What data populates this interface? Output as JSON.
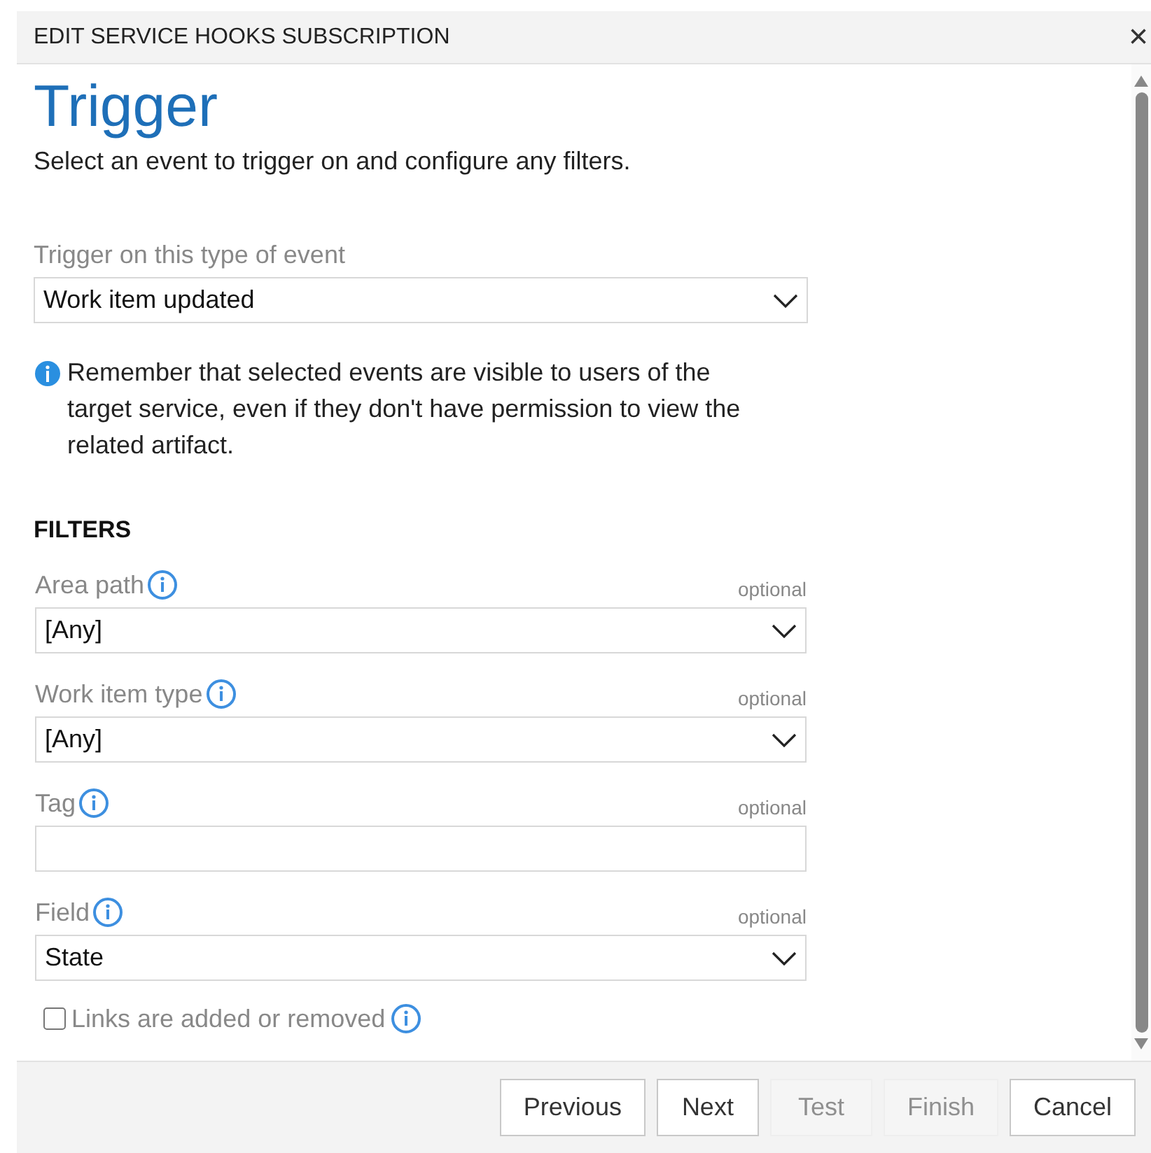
{
  "dialog": {
    "title": "EDIT SERVICE HOOKS SUBSCRIPTION",
    "close": "×"
  },
  "heading": "Trigger",
  "subtitle": "Select an event to trigger on and configure any filters.",
  "event": {
    "label": "Trigger on this type of event",
    "value": "Work item updated"
  },
  "notice": "Remember that selected events are visible to users of the target service, even if they don't have permission to view the related artifact.",
  "filters": {
    "title": "FILTERS",
    "fields": [
      {
        "kind": "select",
        "label": "Area path",
        "hint": "optional",
        "value": "[Any]"
      },
      {
        "kind": "select",
        "label": "Work item type",
        "hint": "optional",
        "value": "[Any]"
      },
      {
        "kind": "text",
        "label": "Tag",
        "hint": "optional"
      },
      {
        "kind": "select",
        "label": "Field",
        "hint": "optional",
        "value": "State"
      }
    ],
    "checkbox": {
      "label": "Links are added or removed",
      "checked": false
    }
  },
  "buttons": [
    {
      "label": "Previous",
      "disabled": false
    },
    {
      "label": "Next",
      "disabled": false
    },
    {
      "label": "Test",
      "disabled": true
    },
    {
      "label": "Finish",
      "disabled": true
    },
    {
      "label": "Cancel",
      "disabled": false
    }
  ]
}
